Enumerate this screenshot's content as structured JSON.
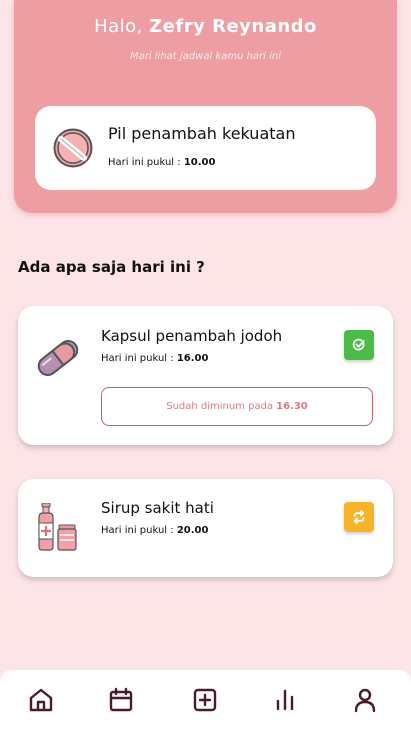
{
  "header": {
    "greeting_prefix": "Halo,",
    "user_name": "Zefry Reynando",
    "subtitle": "Mari lihat jadwal kamu hari ini"
  },
  "hero": {
    "title": "Pil penambah kekuatan",
    "time_label": "Hari ini pukul :",
    "time": "10.00",
    "icon": "pill-icon"
  },
  "section_title": "Ada apa saja hari ini ?",
  "schedule": [
    {
      "title": "Kapsul penambah jodoh",
      "time_label": "Hari ini pukul :",
      "time": "16.00",
      "icon": "capsule-icon",
      "status_icon": "check-icon",
      "status_color": "#4cbb47",
      "taken_label": "Sudah diminum pada",
      "taken_time": "16.30"
    },
    {
      "title": "Sirup sakit hati",
      "time_label": "Hari ini pukul :",
      "time": "20.00",
      "icon": "syrup-bottle-icon",
      "status_icon": "repeat-icon",
      "status_color": "#f7b42b"
    }
  ],
  "nav": [
    {
      "icon": "home-icon"
    },
    {
      "icon": "calendar-icon"
    },
    {
      "icon": "add-square-icon"
    },
    {
      "icon": "stats-icon"
    },
    {
      "icon": "profile-icon"
    }
  ],
  "colors": {
    "background": "#fde4e6",
    "header": "#ee9ea3",
    "accent": "#c0636b"
  }
}
